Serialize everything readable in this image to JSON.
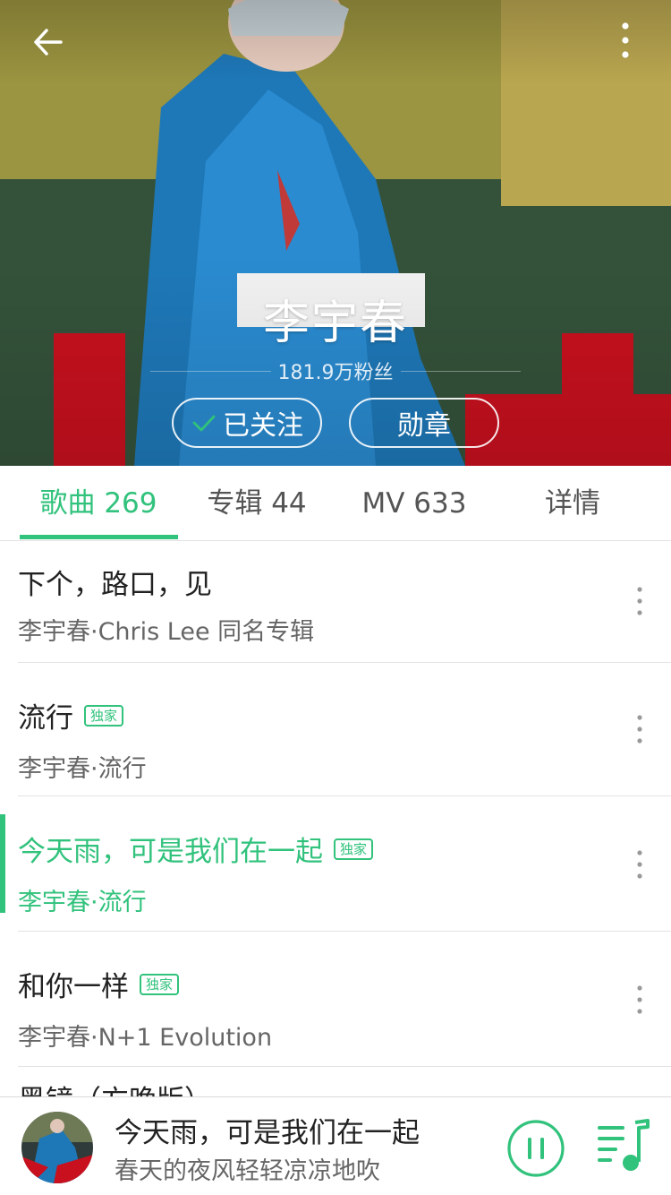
{
  "artist": {
    "name": "李宇春",
    "fans": "181.9万粉丝",
    "follow_label": "已关注",
    "medal_label": "勋章"
  },
  "header": {
    "back_icon": "arrow-left-icon",
    "more_icon": "more-vertical-icon"
  },
  "tabs": [
    {
      "label": "歌曲 269",
      "active": true
    },
    {
      "label": "专辑 44",
      "active": false
    },
    {
      "label": "MV 633",
      "active": false
    },
    {
      "label": "详情",
      "active": false
    }
  ],
  "songs": [
    {
      "title": "下个，路口，见",
      "subtitle": "李宇春·Chris Lee 同名专辑",
      "badge": "",
      "playing": false
    },
    {
      "title": "流行",
      "subtitle": "李宇春·流行",
      "badge": "独家",
      "playing": false
    },
    {
      "title": "今天雨，可是我们在一起",
      "subtitle": "李宇春·流行",
      "badge": "独家",
      "playing": true
    },
    {
      "title": "和你一样",
      "subtitle": "李宇春·N+1 Evolution",
      "badge": "独家",
      "playing": false
    }
  ],
  "partial_song_title": "黑镜（方晚版）",
  "player": {
    "title": "今天雨，可是我们在一起",
    "lyric": "春天的夜风轻轻凉凉地吹",
    "pause_icon": "pause-icon",
    "playlist_icon": "playlist-icon"
  },
  "colors": {
    "accent": "#31c27c",
    "text_primary": "#222222",
    "text_secondary": "#666666"
  }
}
